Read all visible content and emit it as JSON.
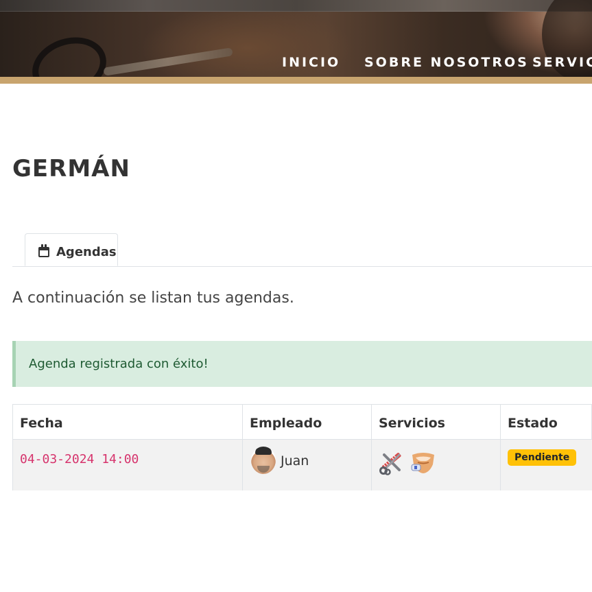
{
  "nav": {
    "items": [
      {
        "label": "INICIO"
      },
      {
        "label": "SOBRE NOSOTROS"
      },
      {
        "label": "SERVICIOS"
      }
    ]
  },
  "main": {
    "title": "GERMÁN",
    "tab": {
      "label": "Agendas",
      "icon": "calendar-icon"
    },
    "intro": "A continuación se listan tus agendas.",
    "alert": {
      "text": "Agenda registrada con éxito!",
      "color": "#d9ede0"
    }
  },
  "table": {
    "headers": [
      "Fecha",
      "Empleado",
      "Servicios",
      "Estado"
    ],
    "rows": [
      {
        "fecha": "04-03-2024 14:00",
        "empleado": "Juan",
        "servicios": [
          "haircut-scissors-comb-icon",
          "beard-trim-icon"
        ],
        "estado": "Pendiente"
      }
    ]
  },
  "colors": {
    "accent_strip": "#c8a46e",
    "badge_pending": "#ffc107",
    "date_text": "#d6336c"
  }
}
